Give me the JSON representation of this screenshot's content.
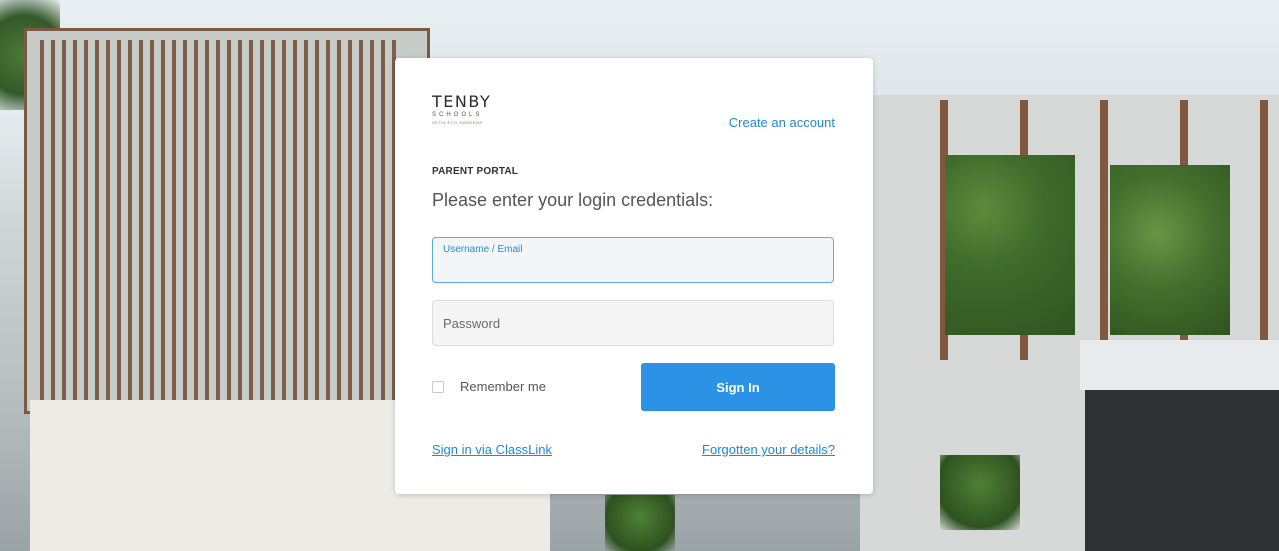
{
  "logo": {
    "name": "TENBY",
    "sub": "SCHOOLS",
    "tagline": "SETIA ECO GARDENS"
  },
  "header": {
    "create_account": "Create an account"
  },
  "portal_label": "PARENT PORTAL",
  "heading": "Please enter your login credentials:",
  "form": {
    "username_label": "Username / Email",
    "username_value": "",
    "password_placeholder": "Password",
    "password_value": "",
    "remember_label": "Remember me",
    "remember_checked": false,
    "signin_label": "Sign In"
  },
  "footer": {
    "classlink": "Sign in via ClassLink",
    "forgot": "Forgotten your details?"
  },
  "colors": {
    "accent": "#2c92e5",
    "link": "#1f88d8"
  }
}
